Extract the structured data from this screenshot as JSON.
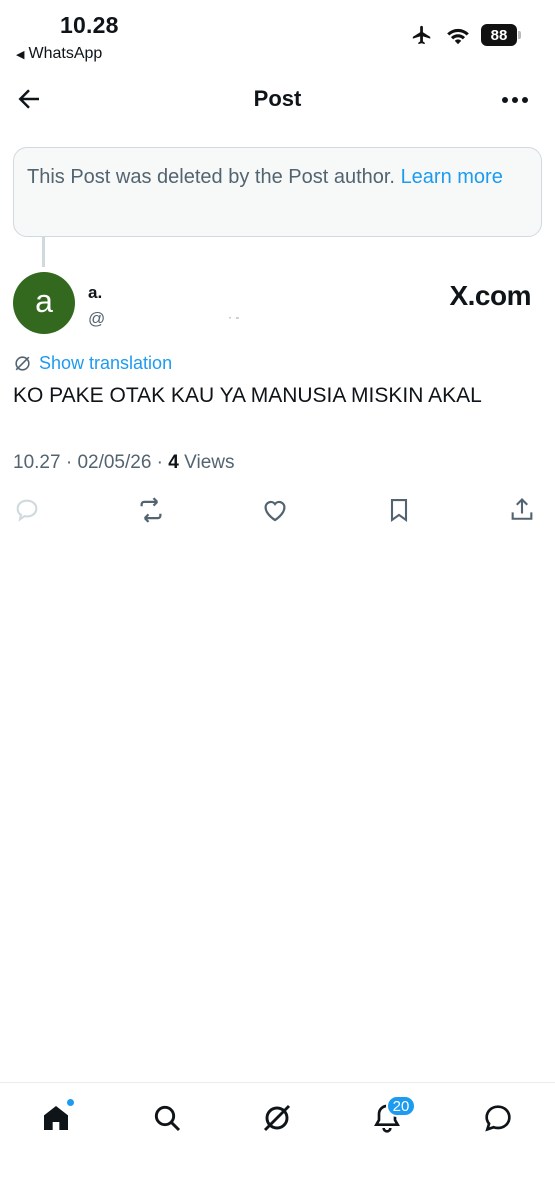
{
  "status_bar": {
    "time": "10.28",
    "back_app": "WhatsApp",
    "battery": "88"
  },
  "header": {
    "title": "Post"
  },
  "deleted_notice": {
    "text": "This Post was deleted by the Post author.",
    "link": "Learn more"
  },
  "author": {
    "avatar_letter": "a",
    "name": "a.",
    "handle": "@",
    "watermark": "X.com"
  },
  "post": {
    "translation_label": "Show translation",
    "text": "KO PAKE OTAK KAU YA MANUSIA MISKIN AKAL",
    "time": "10.27",
    "date": "02/05/26",
    "views_count": "4",
    "views_label": "Views"
  },
  "bottom_nav": {
    "notifications_badge": "20"
  },
  "colors": {
    "accent": "#1d9bf0",
    "avatar_bg": "#33691e",
    "muted": "#536471"
  }
}
